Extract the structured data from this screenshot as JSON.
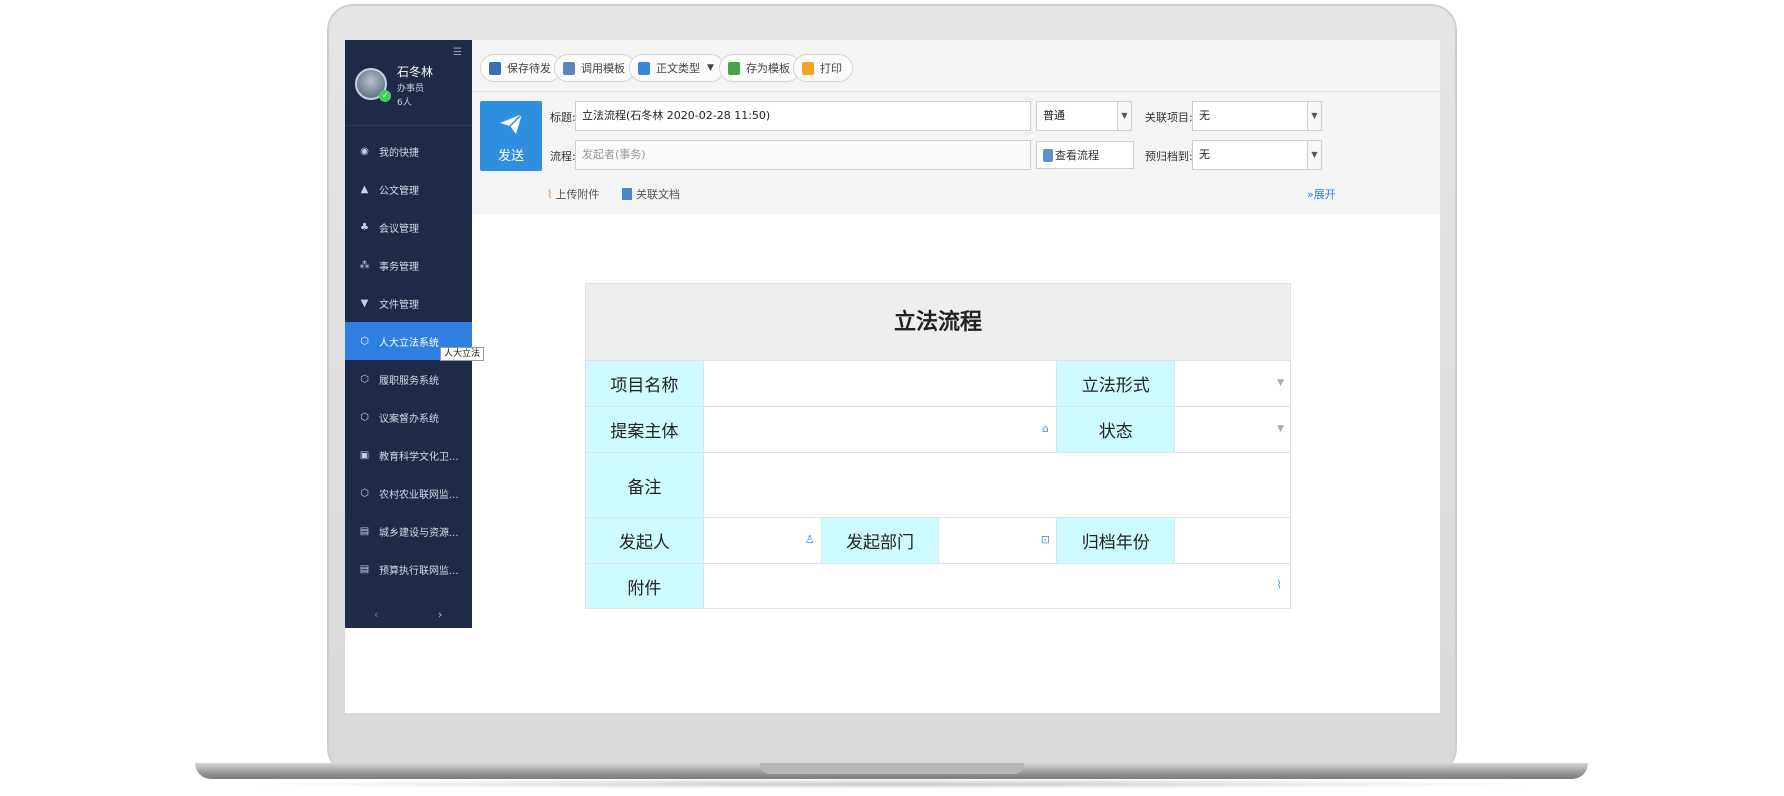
{
  "user": {
    "name": "石冬林",
    "role": "办事员",
    "count": "6人"
  },
  "sidebar": {
    "items": [
      {
        "label": "我的快捷",
        "icon": "shortcut-icon"
      },
      {
        "label": "公文管理",
        "icon": "user-icon"
      },
      {
        "label": "会议管理",
        "icon": "meeting-icon"
      },
      {
        "label": "事务管理",
        "icon": "affairs-icon"
      },
      {
        "label": "文件管理",
        "icon": "graduation-cap-icon"
      },
      {
        "label": "人大立法系统",
        "icon": "cube-icon",
        "active": true
      },
      {
        "label": "履职服务系统",
        "icon": "cube-icon"
      },
      {
        "label": "议案督办系统",
        "icon": "cube-icon"
      },
      {
        "label": "教育科学文化卫...",
        "icon": "monitor-icon"
      },
      {
        "label": "农村农业联网监...",
        "icon": "cube-icon"
      },
      {
        "label": "城乡建设与资源...",
        "icon": "document-icon"
      },
      {
        "label": "预算执行联网监...",
        "icon": "document-icon"
      }
    ],
    "tooltip": "人大立法",
    "pager_prev": "‹",
    "pager_next": "›"
  },
  "toolbar": {
    "save_draft": "保存待发",
    "use_template": "调用模板",
    "doc_type": "正文类型",
    "save_template": "存为模板",
    "print": "打印"
  },
  "header": {
    "send_label": "发送",
    "title_label": "标题:",
    "title_value": "立法流程(石冬林 2020-02-28 11:50)",
    "priority_value": "普通",
    "related_project_label": "关联项目:",
    "related_project_value": "无",
    "flow_label": "流程:",
    "flow_placeholder": "发起者(事务)",
    "view_flow": "查看流程",
    "archive_label": "预归档到:",
    "archive_value": "无",
    "upload_attachment": "上传附件",
    "related_doc": "关联文档",
    "expand": "展开"
  },
  "form": {
    "title": "立法流程",
    "project_name": "项目名称",
    "legislation_form": "立法形式",
    "proposer": "提案主体",
    "status": "状态",
    "remarks": "备注",
    "initiator": "发起人",
    "initiating_dept": "发起部门",
    "archive_year": "归档年份",
    "attachment": "附件"
  },
  "colors": {
    "sidebar_bg": "#1e2a48",
    "active": "#2f7fe0",
    "label_cell": "#cefbfd",
    "send": "#2e8ee0"
  }
}
